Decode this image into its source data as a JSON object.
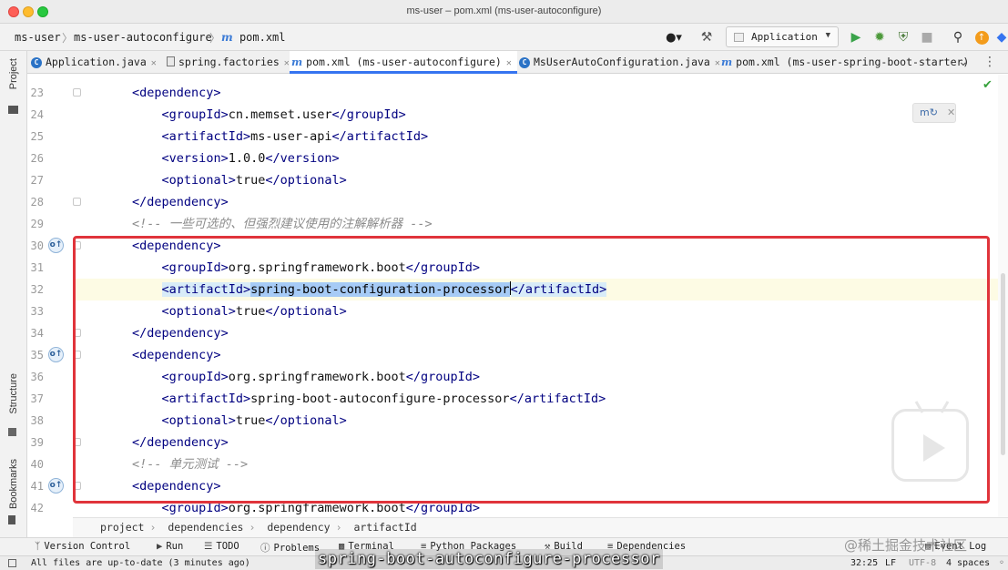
{
  "window": {
    "title": "ms-user – pom.xml (ms-user-autoconfigure)"
  },
  "nav": {
    "crumbs": [
      "ms-user",
      "ms-user-autoconfigure",
      "pom.xml"
    ],
    "run_config": "Application"
  },
  "tabs": [
    {
      "label": "Application.java",
      "icon": "class-icon",
      "active": false
    },
    {
      "label": "spring.factories",
      "icon": "file-icon",
      "active": false
    },
    {
      "label": "pom.xml (ms-user-autoconfigure)",
      "icon": "maven-icon",
      "active": true
    },
    {
      "label": "MsUserAutoConfiguration.java",
      "icon": "class-icon",
      "active": false
    },
    {
      "label": "pom.xml (ms-user-spring-boot-starter)",
      "icon": "maven-icon",
      "active": false
    }
  ],
  "left_strip": {
    "project": "Project",
    "structure": "Structure",
    "bookmarks": "Bookmarks"
  },
  "editor": {
    "lines": [
      {
        "no": "23",
        "parts": [
          {
            "t": "        "
          },
          {
            "t": "<dependency>",
            "c": "tag"
          }
        ]
      },
      {
        "no": "24",
        "parts": [
          {
            "t": "            "
          },
          {
            "t": "<groupId>",
            "c": "tag"
          },
          {
            "t": "cn.memset.user"
          },
          {
            "t": "</groupId>",
            "c": "tag"
          }
        ]
      },
      {
        "no": "25",
        "parts": [
          {
            "t": "            "
          },
          {
            "t": "<artifactId>",
            "c": "tag"
          },
          {
            "t": "ms-user-api"
          },
          {
            "t": "</artifactId>",
            "c": "tag"
          }
        ]
      },
      {
        "no": "26",
        "parts": [
          {
            "t": "            "
          },
          {
            "t": "<version>",
            "c": "tag"
          },
          {
            "t": "1.0.0"
          },
          {
            "t": "</version>",
            "c": "tag"
          }
        ]
      },
      {
        "no": "27",
        "parts": [
          {
            "t": "            "
          },
          {
            "t": "<optional>",
            "c": "tag"
          },
          {
            "t": "true"
          },
          {
            "t": "</optional>",
            "c": "tag"
          }
        ]
      },
      {
        "no": "28",
        "parts": [
          {
            "t": "        "
          },
          {
            "t": "</dependency>",
            "c": "tag"
          }
        ]
      },
      {
        "no": "29",
        "parts": [
          {
            "t": "        "
          },
          {
            "t": "<!-- 一些可选的、但强烈建议使用的注解解析器 -->",
            "c": "cmt"
          }
        ]
      },
      {
        "no": "30",
        "parts": [
          {
            "t": "        "
          },
          {
            "t": "<dependency>",
            "c": "tag"
          }
        ]
      },
      {
        "no": "31",
        "parts": [
          {
            "t": "            "
          },
          {
            "t": "<groupId>",
            "c": "tag"
          },
          {
            "t": "org.springframework.boot"
          },
          {
            "t": "</groupId>",
            "c": "tag"
          }
        ]
      },
      {
        "no": "32",
        "parts": [
          {
            "t": "            "
          },
          {
            "t": "<artifactId>",
            "c": "tag hl"
          },
          {
            "t": "spring-boot-configuration-processor",
            "c": "sel"
          },
          {
            "t": "",
            "c": "caret"
          },
          {
            "t": "</artifactId>",
            "c": "tag hl"
          }
        ]
      },
      {
        "no": "33",
        "parts": [
          {
            "t": "            "
          },
          {
            "t": "<optional>",
            "c": "tag"
          },
          {
            "t": "true"
          },
          {
            "t": "</optional>",
            "c": "tag"
          }
        ]
      },
      {
        "no": "34",
        "parts": [
          {
            "t": "        "
          },
          {
            "t": "</dependency>",
            "c": "tag"
          }
        ]
      },
      {
        "no": "35",
        "parts": [
          {
            "t": "        "
          },
          {
            "t": "<dependency>",
            "c": "tag"
          }
        ]
      },
      {
        "no": "36",
        "parts": [
          {
            "t": "            "
          },
          {
            "t": "<groupId>",
            "c": "tag"
          },
          {
            "t": "org.springframework.boot"
          },
          {
            "t": "</groupId>",
            "c": "tag"
          }
        ]
      },
      {
        "no": "37",
        "parts": [
          {
            "t": "            "
          },
          {
            "t": "<artifactId>",
            "c": "tag"
          },
          {
            "t": "spring-boot-autoconfigure-processor"
          },
          {
            "t": "</artifactId>",
            "c": "tag"
          }
        ]
      },
      {
        "no": "38",
        "parts": [
          {
            "t": "            "
          },
          {
            "t": "<optional>",
            "c": "tag"
          },
          {
            "t": "true"
          },
          {
            "t": "</optional>",
            "c": "tag"
          }
        ]
      },
      {
        "no": "39",
        "parts": [
          {
            "t": "        "
          },
          {
            "t": "</dependency>",
            "c": "tag"
          }
        ]
      },
      {
        "no": "40",
        "parts": [
          {
            "t": "        "
          },
          {
            "t": "<!-- 单元测试 -->",
            "c": "cmt"
          }
        ]
      },
      {
        "no": "41",
        "parts": [
          {
            "t": "        "
          },
          {
            "t": "<dependency>",
            "c": "tag"
          }
        ]
      },
      {
        "no": "42",
        "parts": [
          {
            "t": "            "
          },
          {
            "t": "<groupId>",
            "c": "tag"
          },
          {
            "t": "org.springframework.boot"
          },
          {
            "t": "</groupId>",
            "c": "tag"
          }
        ]
      }
    ],
    "current_line": "32",
    "maven_badge_lines": [
      "30",
      "35",
      "41"
    ],
    "fold_lines": [
      "23",
      "28",
      "30",
      "34",
      "35",
      "39",
      "41"
    ]
  },
  "editor_breadcrumb": [
    "project",
    "dependencies",
    "dependency",
    "artifactId"
  ],
  "tool_windows": [
    {
      "label": "Version Control",
      "icon": "branch-icon"
    },
    {
      "label": "Run",
      "icon": "run-icon"
    },
    {
      "label": "TODO",
      "icon": "list-icon"
    },
    {
      "label": "Problems",
      "icon": "info-icon"
    },
    {
      "label": "Terminal",
      "icon": "terminal-icon"
    },
    {
      "label": "Python Packages",
      "icon": "layers-icon"
    },
    {
      "label": "Build",
      "icon": "hammer-icon"
    },
    {
      "label": "Dependencies",
      "icon": "layers-icon"
    },
    {
      "label": "Event Log",
      "icon": "log-icon"
    }
  ],
  "status": {
    "message": "All files are up-to-date (3 minutes ago)",
    "position": "32:25",
    "line_sep": "LF",
    "encoding": "UTF-8",
    "indent": "4 spaces"
  },
  "overlay": {
    "subtitle": "spring-boot-autoconfigure-processor",
    "watermark": "@稀土掘金技术社区"
  },
  "colors": {
    "accent": "#3574f0",
    "highlight_box": "#e0343b",
    "selection": "#a6cbf6",
    "xml_tag": "#000080"
  }
}
